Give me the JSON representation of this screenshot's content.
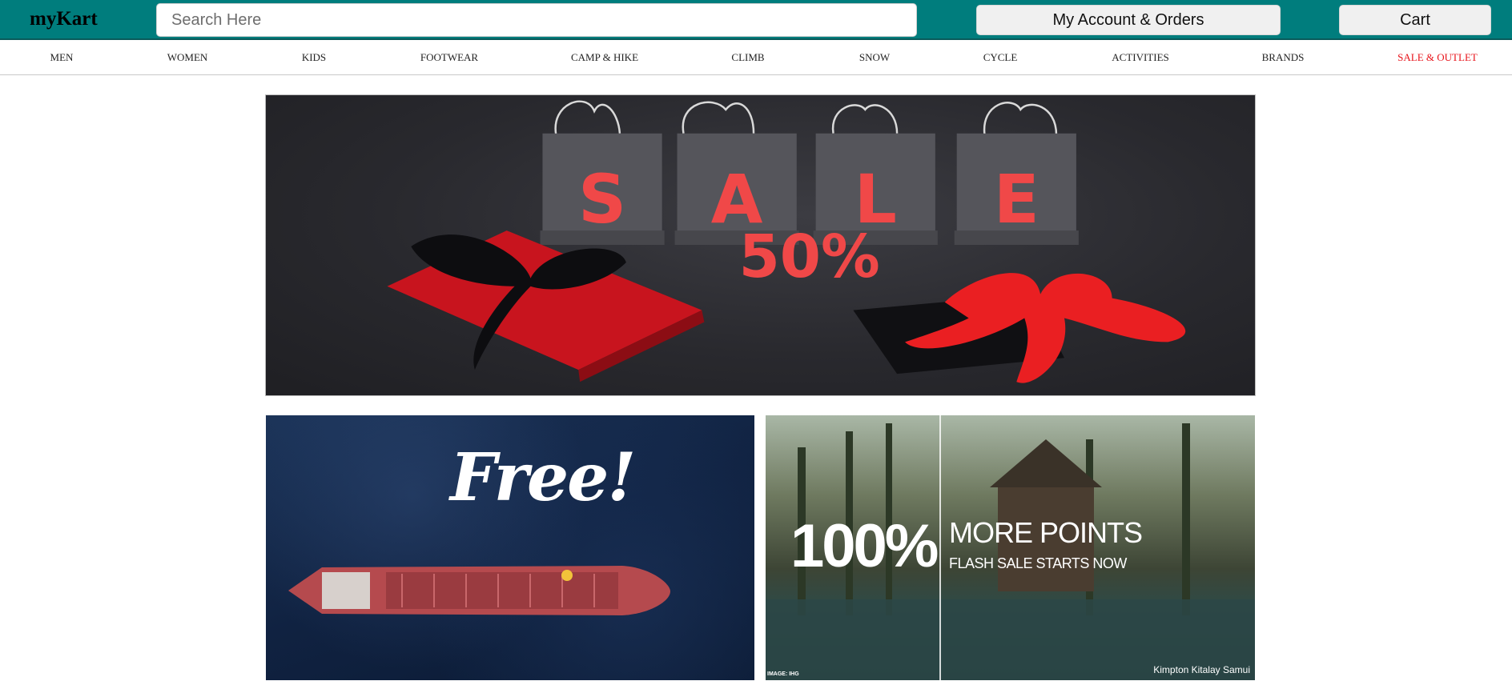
{
  "header": {
    "logo": "myKart",
    "search_placeholder": "Search Here",
    "account_label": "My Account & Orders",
    "cart_label": "Cart",
    "bg_color": "#007d7d"
  },
  "nav": {
    "items": [
      {
        "label": "MEN"
      },
      {
        "label": "WOMEN"
      },
      {
        "label": "KIDS"
      },
      {
        "label": "FOOTWEAR"
      },
      {
        "label": "CAMP & HIKE"
      },
      {
        "label": "CLIMB"
      },
      {
        "label": "SNOW"
      },
      {
        "label": "CYCLE"
      },
      {
        "label": "ACTIVITIES"
      },
      {
        "label": "BRANDS"
      },
      {
        "label": "SALE & OUTLET"
      }
    ],
    "sale_color": "#e8141b"
  },
  "banners": {
    "hero": {
      "word": "SALE",
      "discount": "50%"
    },
    "shipping": {
      "headline": "Free!"
    },
    "points": {
      "big": "100%",
      "headline": "MORE POINTS",
      "subline": "FLASH SALE STARTS NOW",
      "credit_left": "IMAGE: IHG",
      "credit_right": "Kimpton Kitalay Samui"
    }
  }
}
